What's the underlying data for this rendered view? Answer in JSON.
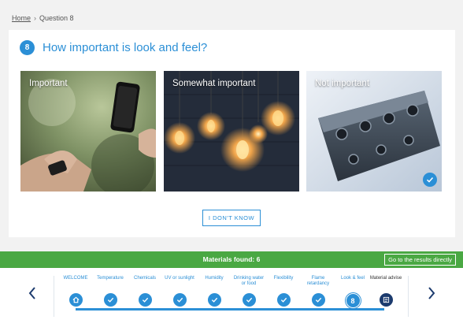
{
  "breadcrumb": {
    "home": "Home",
    "current": "Question 8"
  },
  "question": {
    "number": "8",
    "title": "How important is look and feel?"
  },
  "options": [
    {
      "label": "Important",
      "selected": false
    },
    {
      "label": "Somewhat important",
      "selected": false
    },
    {
      "label": "Not important",
      "selected": true
    }
  ],
  "dont_know": "I DON'T KNOW",
  "status": {
    "materials_found": "Materials found: 6",
    "results_button": "Go to the results directly"
  },
  "steps": [
    {
      "label": "WELCOME",
      "icon": "home-icon",
      "state": "done"
    },
    {
      "label": "Temperature",
      "icon": "check-icon",
      "state": "done"
    },
    {
      "label": "Chemicals",
      "icon": "check-icon",
      "state": "done"
    },
    {
      "label": "UV or sunlight",
      "icon": "check-icon",
      "state": "done"
    },
    {
      "label": "Humidity",
      "icon": "check-icon",
      "state": "done"
    },
    {
      "label": "Drinking water or food",
      "icon": "check-icon",
      "state": "done"
    },
    {
      "label": "Flexibility",
      "icon": "check-icon",
      "state": "done"
    },
    {
      "label": "Flame retardancy",
      "icon": "check-icon",
      "state": "done"
    },
    {
      "label": "Look & feel",
      "number": "8",
      "state": "current"
    },
    {
      "label": "Material advise",
      "icon": "list-icon",
      "state": "upcoming"
    }
  ],
  "colors": {
    "accent": "#2b8fd6",
    "success": "#4aa843",
    "dark_step": "#1c3b6e"
  }
}
